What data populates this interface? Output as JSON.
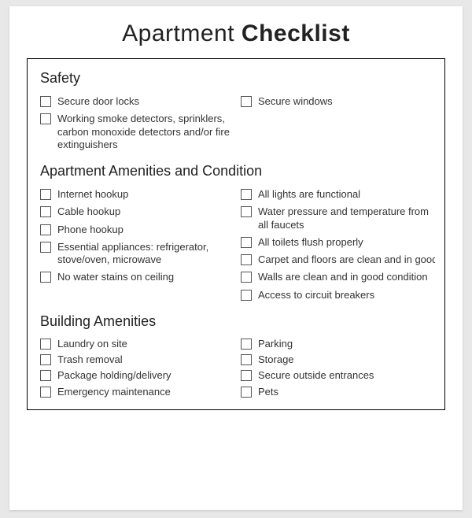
{
  "title": {
    "part1": "Apartment",
    "part2": "Checklist"
  },
  "sections": [
    {
      "heading": "Safety",
      "left": [
        "Secure door locks",
        "Working smoke detectors, sprinklers, carbon monoxide detectors and/or fire extinguishers"
      ],
      "right": [
        "Secure windows"
      ]
    },
    {
      "heading": "Apartment Amenities and Condition",
      "left": [
        "Internet hookup",
        "Cable hookup",
        "Phone hookup",
        "Essential appliances: refrigerator, stove/oven, microwave",
        "No water stains on ceiling"
      ],
      "right": [
        "All lights are functional",
        "Water pressure and temperature from all faucets",
        "All toilets flush properly",
        "Carpet and floors are clean and in good condition",
        "Walls are clean and in good condition",
        "Access to circuit breakers"
      ]
    },
    {
      "heading": "Building Amenities",
      "left": [
        "Laundry on site",
        "Trash removal",
        "Package holding/delivery",
        "Emergency maintenance"
      ],
      "right": [
        "Parking",
        "Storage",
        "Secure outside entrances",
        "Pets"
      ]
    }
  ]
}
